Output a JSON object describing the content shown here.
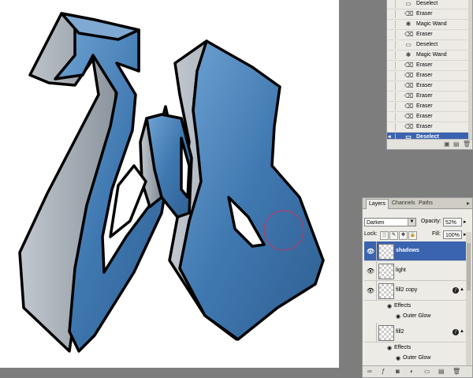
{
  "history": {
    "items": [
      {
        "icon": "deselect-icon",
        "glyph": "▭",
        "label": "Deselect"
      },
      {
        "icon": "eraser-icon",
        "glyph": "⌫",
        "label": "Eraser"
      },
      {
        "icon": "magic-wand-icon",
        "glyph": "✱",
        "label": "Magic Wand"
      },
      {
        "icon": "eraser-icon",
        "glyph": "⌫",
        "label": "Eraser"
      },
      {
        "icon": "deselect-icon",
        "glyph": "▭",
        "label": "Deselect"
      },
      {
        "icon": "magic-wand-icon",
        "glyph": "✱",
        "label": "Magic Wand"
      },
      {
        "icon": "eraser-icon",
        "glyph": "⌫",
        "label": "Eraser"
      },
      {
        "icon": "eraser-icon",
        "glyph": "⌫",
        "label": "Eraser"
      },
      {
        "icon": "eraser-icon",
        "glyph": "⌫",
        "label": "Eraser"
      },
      {
        "icon": "eraser-icon",
        "glyph": "⌫",
        "label": "Eraser"
      },
      {
        "icon": "eraser-icon",
        "glyph": "⌫",
        "label": "Eraser"
      },
      {
        "icon": "eraser-icon",
        "glyph": "⌫",
        "label": "Eraser"
      },
      {
        "icon": "eraser-icon",
        "glyph": "⌫",
        "label": "Eraser"
      },
      {
        "icon": "deselect-icon",
        "glyph": "▭",
        "label": "Deselect",
        "selected": true
      }
    ]
  },
  "layers_panel": {
    "tabs": [
      "Layers",
      "Channels",
      "Paths"
    ],
    "menu_glyph": "▸",
    "blend_mode": "Darken",
    "opacity_label": "Opacity:",
    "opacity_value": "52%",
    "lock_label": "Lock:",
    "fill_label": "Fill:",
    "fill_value": "100%",
    "layers": [
      {
        "name": "shadows",
        "visible": true,
        "selected": true
      },
      {
        "name": "light",
        "visible": true
      },
      {
        "name": "fill2 copy",
        "visible": true,
        "has_fx": true,
        "effects_label": "Effects",
        "effect": "Outer Glow"
      },
      {
        "name": "fill2",
        "visible": false,
        "has_fx": true,
        "effects_label": "Effects",
        "effect": "Outer Glow"
      }
    ],
    "fx_glyph": "ƒ"
  },
  "colors": {
    "accent": "#3a63b0",
    "shape_blue": "#4a82b8",
    "shape_gray": "#9aa2ac",
    "brush_circle": "#d0305a"
  }
}
